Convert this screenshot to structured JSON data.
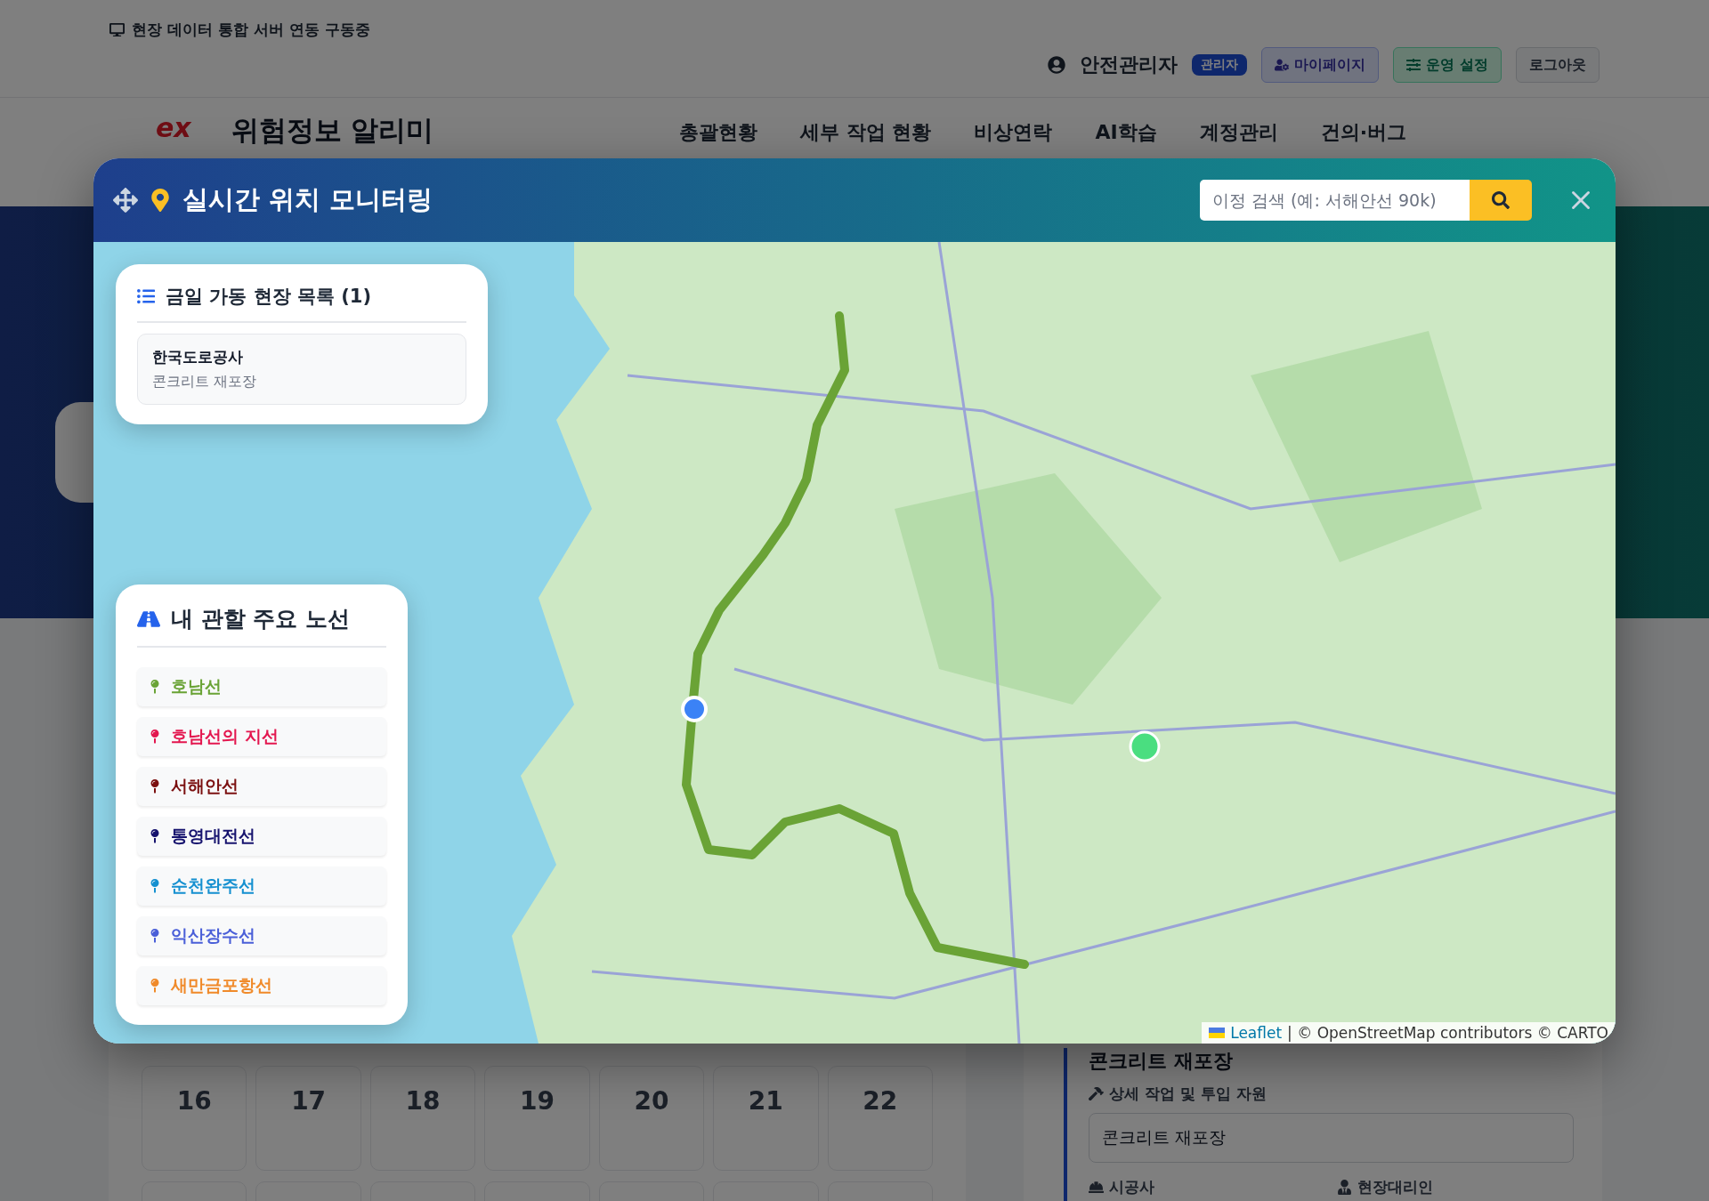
{
  "top_bar": {
    "status": "현장 데이터 통합 서버 연동 구동중",
    "user": "안전관리자",
    "role_badge": "관리자",
    "buttons": [
      {
        "kind": "mypage",
        "label": "마이페이지"
      },
      {
        "kind": "settings",
        "label": "운영 설정"
      },
      {
        "kind": "logout",
        "label": "로그아웃"
      }
    ]
  },
  "nav": {
    "logo": "ex",
    "title": "위험정보 알리미",
    "items": [
      "총괄현황",
      "세부 작업 현황",
      "비상연락",
      "AI학습",
      "계정관리",
      "건의·버그"
    ]
  },
  "calendar": {
    "week": [
      "16",
      "17",
      "18",
      "19",
      "20",
      "21",
      "22"
    ]
  },
  "detail_panel": {
    "heading": "콘크리트 재포장",
    "work_label": "상세 작업 및 투입 자원",
    "work_value": "콘크리트 재포장",
    "contractor_label": "시공사",
    "agent_label": "현장대리인"
  },
  "modal": {
    "title": "실시간 위치 모니터링",
    "search": {
      "placeholder": "이정 검색 (예: 서해안선 90k)"
    },
    "site_list": {
      "title": "금일 가동 현장 목록 (1)",
      "items": [
        {
          "name": "한국도로공사",
          "work": "콘크리트 재포장"
        }
      ]
    },
    "routes": {
      "title": "내 관할 주요 노선",
      "items": [
        {
          "name": "호남선",
          "color": "#6aa336"
        },
        {
          "name": "호남선의 지선",
          "color": "#e3174f"
        },
        {
          "name": "서해안선",
          "color": "#7b1010"
        },
        {
          "name": "통영대전선",
          "color": "#16136e"
        },
        {
          "name": "순천완주선",
          "color": "#1590d0"
        },
        {
          "name": "익산장수선",
          "color": "#4a5fd8"
        },
        {
          "name": "새만금포항선",
          "color": "#f08a2a"
        }
      ]
    },
    "attribution": {
      "link": "Leaflet",
      "text": "| © OpenStreetMap contributors © CARTO"
    }
  }
}
